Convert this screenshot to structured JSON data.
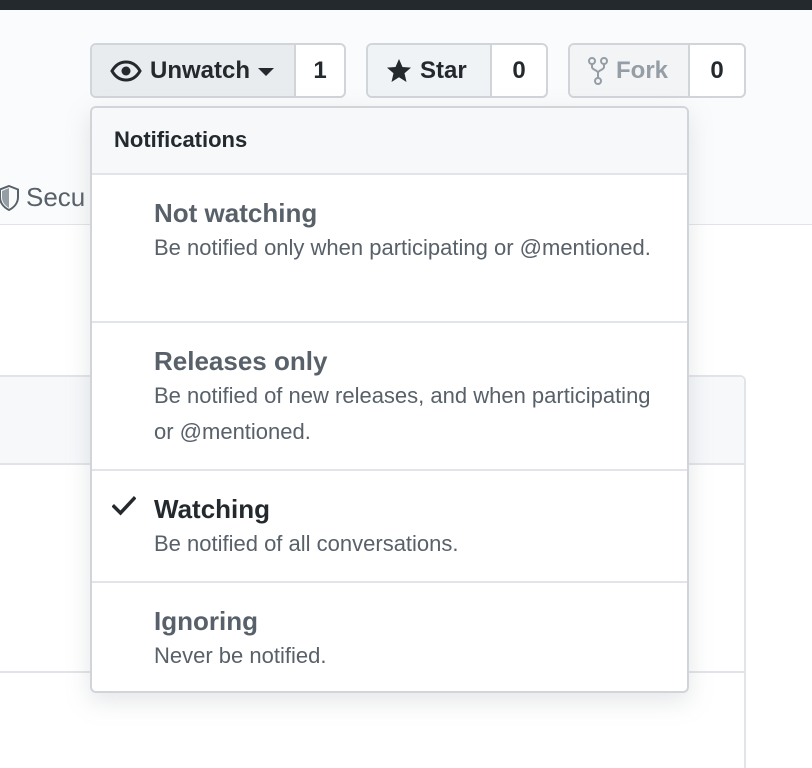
{
  "repo_actions": {
    "watch": {
      "label": "Unwatch",
      "count": "1",
      "icon": "eye-icon"
    },
    "star": {
      "label": "Star",
      "count": "0",
      "icon": "star-icon"
    },
    "fork": {
      "label": "Fork",
      "count": "0",
      "icon": "fork-icon"
    }
  },
  "tabs": {
    "security": {
      "label": "Secu",
      "icon": "shield-icon"
    }
  },
  "notifications_menu": {
    "header": "Notifications",
    "selected": "Watching",
    "items": [
      {
        "title": "Not watching",
        "description": "Be notified only when participating or @mentioned."
      },
      {
        "title": "Releases only",
        "description": "Be notified of new releases, and when participating or @mentioned."
      },
      {
        "title": "Watching",
        "description": "Be notified of all conversations."
      },
      {
        "title": "Ignoring",
        "description": "Never be notified."
      }
    ]
  },
  "colors": {
    "header_bar": "#24292e",
    "text_primary": "#24292e",
    "text_muted": "#586069",
    "border": "#d1d5da",
    "subtle_bg": "#f6f8fa"
  }
}
